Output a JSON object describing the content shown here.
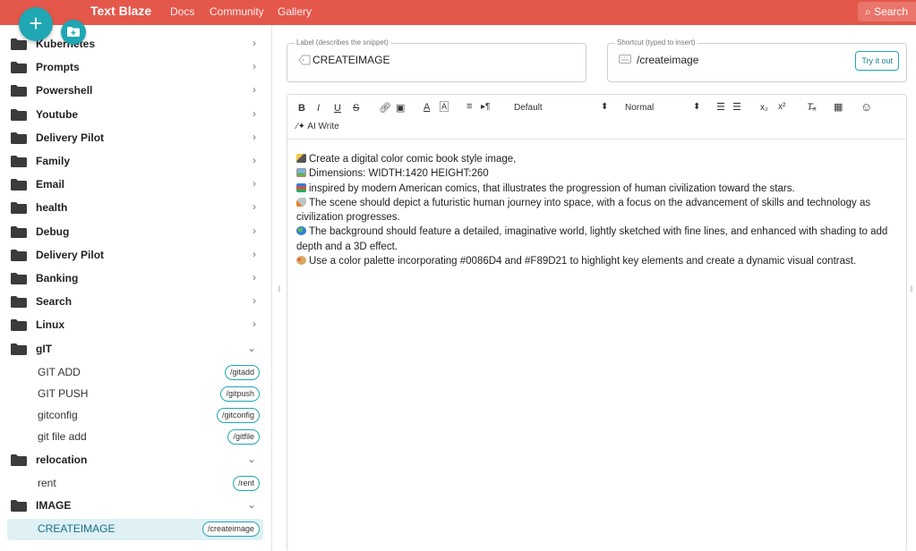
{
  "topbar": {
    "brand": "Text Blaze",
    "nav": [
      "Docs",
      "Community",
      "Gallery"
    ],
    "search_label": "Search",
    "accent": "#e4574b"
  },
  "fab": {
    "plus": "+",
    "color": "#1fa7b3"
  },
  "sidebar": {
    "folders": [
      {
        "label": "Kubernetes"
      },
      {
        "label": "Prompts"
      },
      {
        "label": "Powershell"
      },
      {
        "label": "Youtube"
      },
      {
        "label": "Delivery Pilot"
      },
      {
        "label": "Family"
      },
      {
        "label": "Email"
      },
      {
        "label": "health"
      },
      {
        "label": "Debug"
      },
      {
        "label": "Delivery Pilot"
      },
      {
        "label": "Banking"
      },
      {
        "label": "Search"
      },
      {
        "label": "Linux"
      }
    ],
    "git_folder": {
      "label": "gIT"
    },
    "git_snippets": [
      {
        "label": "GIT ADD",
        "shortcut": "/gitadd"
      },
      {
        "label": "GIT PUSH",
        "shortcut": "/gitpush"
      },
      {
        "label": "gitconfig",
        "shortcut": "/gitconfig"
      },
      {
        "label": "git file add",
        "shortcut": "/gitfile"
      }
    ],
    "relocation_folder": {
      "label": "relocation"
    },
    "relocation_snippets": [
      {
        "label": "rent",
        "shortcut": "/rent"
      }
    ],
    "image_folder": {
      "label": "IMAGE"
    },
    "image_snippets": [
      {
        "label": "CREATEIMAGE",
        "shortcut": "/createimage"
      }
    ],
    "chevron_right": "›",
    "chevron_down": "⌄"
  },
  "label_field": {
    "legend": "Label (describes the snippet)",
    "value": "CREATEIMAGE"
  },
  "shortcut_field": {
    "legend": "Shortcut (typed to insert)",
    "value": "/createimage",
    "try_label": "Try it out"
  },
  "toolbar": {
    "bold": "B",
    "italic": "I",
    "underline": "U",
    "strike": "S",
    "font_select": "Default",
    "size_select": "Normal",
    "subscript": "x₂",
    "superscript": "x²",
    "ai_write": "AI Write"
  },
  "content": {
    "lines": [
      "Create a digital color comic book style image,",
      "Dimensions: WIDTH:1420 HEIGHT:260",
      "inspired by modern American comics, that illustrates the progression of human civilization toward the stars.",
      "The scene should depict a futuristic human journey into space, with a focus on the advancement of skills and technology as civilization progresses.",
      "The background should feature a detailed, imaginative world, lightly sketched with fine lines, and enhanced with shading to add depth and a 3D effect.",
      "Use a color palette incorporating #0086D4 and #F89D21 to highlight key elements and create a dynamic visual contrast."
    ],
    "emoji_icons": [
      "pencil-icon",
      "framed-picture-icon",
      "books-icon",
      "rocket-icon",
      "globe-icon",
      "palette-icon"
    ]
  }
}
